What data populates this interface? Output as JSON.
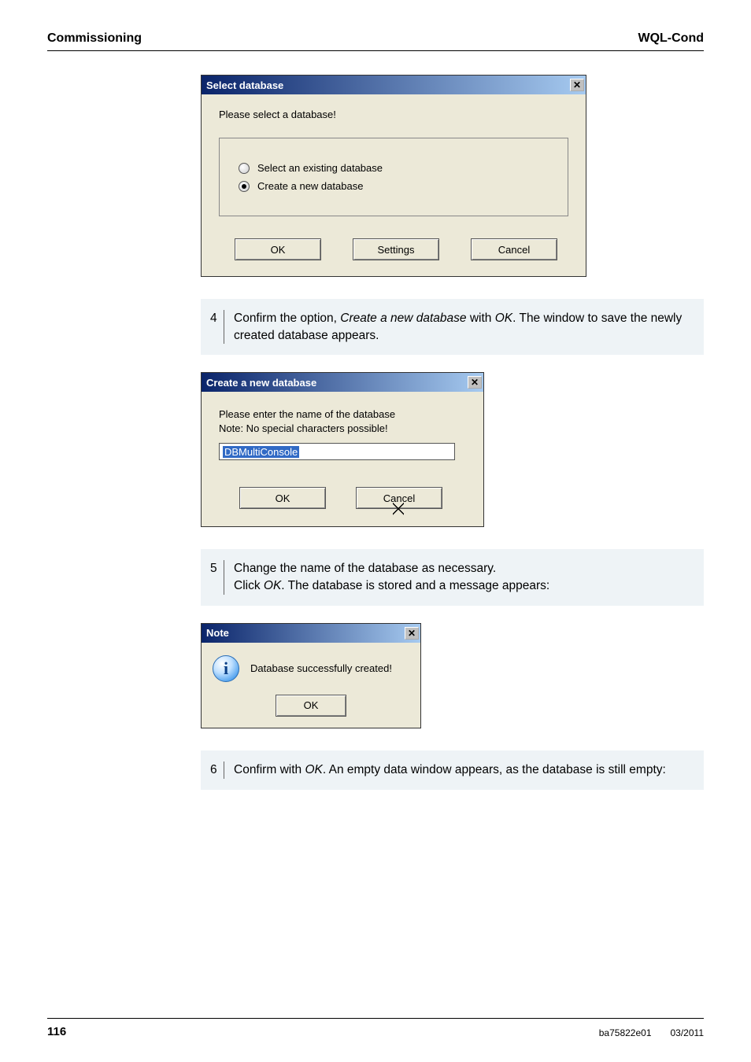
{
  "header": {
    "left": "Commissioning",
    "right": "WQL-Cond"
  },
  "dialog_select": {
    "title": "Select database",
    "prompt": "Please select a database!",
    "radio_existing": "Select an existing database",
    "radio_create": "Create a new database",
    "btn_ok": "OK",
    "btn_settings": "Settings",
    "btn_cancel": "Cancel"
  },
  "step4": {
    "num": "4",
    "text_a": "Confirm the option, ",
    "em1": "Create a new database",
    "text_b": " with ",
    "em2": "OK",
    "text_c": ". The window to save the newly created database appears."
  },
  "dialog_create": {
    "title": "Create a new database",
    "prompt_line1": "Please enter the name of the database",
    "prompt_line2": "Note: No special characters possible!",
    "value": "DBMultiConsole",
    "btn_ok": "OK",
    "btn_cancel": "Cancel"
  },
  "step5": {
    "num": "5",
    "line1": "Change the name of the database as necessary.",
    "line2a": "Click ",
    "em": "OK",
    "line2b": ". The database is stored and a message appears:"
  },
  "dialog_note": {
    "title": "Note",
    "message": "Database successfully created!",
    "btn_ok": "OK"
  },
  "step6": {
    "num": "6",
    "text_a": "Confirm with ",
    "em": "OK",
    "text_b": ". An empty data window appears, as the database is still empty:"
  },
  "footer": {
    "page": "116",
    "doc": "ba75822e01",
    "date": "03/2011"
  }
}
